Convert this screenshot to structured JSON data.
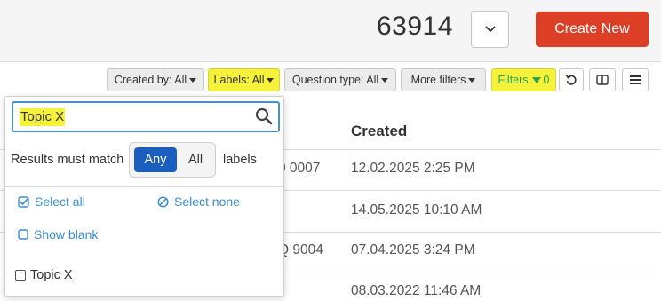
{
  "header": {
    "count": "63914",
    "create_label": "Create New",
    "create_color": "#dd3f26"
  },
  "filters": {
    "created_by": "Created by: All",
    "labels": "Labels: All",
    "question_type": "Question type: All",
    "more_filters": "More filters",
    "filters_label": "Filters",
    "filters_count": "0"
  },
  "table": {
    "created_header": "Created",
    "rows": [
      {
        "id_partial": "0 0007",
        "created": "12.02.2025 2:25 PM"
      },
      {
        "id_partial": "",
        "created": "14.05.2025 10:10 AM"
      },
      {
        "id_partial": "Q 9004",
        "created": "07.04.2025 3:24 PM"
      },
      {
        "id_partial": "",
        "created": "08.03.2022 11:46 AM"
      }
    ]
  },
  "label_dropdown": {
    "search_value": "Topic X",
    "match_text": "Results must match",
    "match_any": "Any",
    "match_all": "All",
    "match_suffix": "labels",
    "select_all": "Select all",
    "select_none": "Select none",
    "show_blank": "Show blank",
    "options": [
      "Topic X"
    ]
  },
  "colors": {
    "highlight": "#f6f23a",
    "link": "#3a8fd6",
    "active_segment": "#1a5fbf",
    "filters_green": "#2ea44f"
  }
}
